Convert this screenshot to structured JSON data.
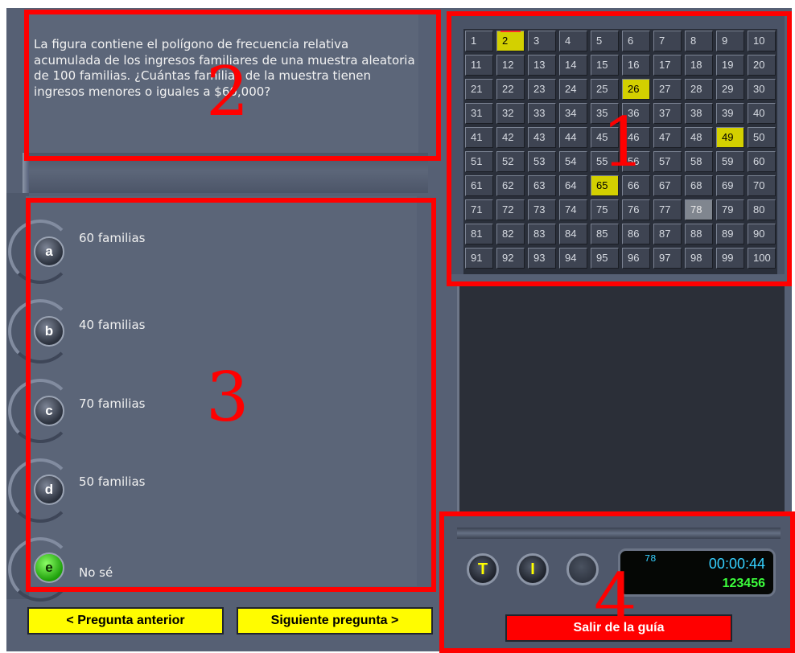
{
  "question": {
    "text": "La figura contiene el polígono de frecuencia relativa acumulada de los ingresos familiares de una muestra aleatoria de 100 familias. ¿Cuántas familias de la muestra tienen ingresos menores o iguales a $60,000?"
  },
  "answers": [
    {
      "letter": "a",
      "label": "60 familias"
    },
    {
      "letter": "b",
      "label": "40 familias"
    },
    {
      "letter": "c",
      "label": "70 familias"
    },
    {
      "letter": "d",
      "label": "50 familias"
    },
    {
      "letter": "e",
      "label": "No sé"
    }
  ],
  "nav": {
    "prev_label": "< Pregunta anterior",
    "next_label": "Siguiente pregunta >"
  },
  "grid": {
    "numbers": [
      "1",
      "2",
      "3",
      "4",
      "5",
      "6",
      "7",
      "8",
      "9",
      "10",
      "11",
      "12",
      "13",
      "14",
      "15",
      "16",
      "17",
      "18",
      "19",
      "20",
      "21",
      "22",
      "23",
      "24",
      "25",
      "26",
      "27",
      "28",
      "29",
      "30",
      "31",
      "32",
      "33",
      "34",
      "35",
      "36",
      "37",
      "38",
      "39",
      "40",
      "41",
      "42",
      "43",
      "44",
      "45",
      "46",
      "47",
      "48",
      "49",
      "50",
      "51",
      "52",
      "53",
      "54",
      "55",
      "56",
      "57",
      "58",
      "59",
      "60",
      "61",
      "62",
      "63",
      "64",
      "65",
      "66",
      "67",
      "68",
      "69",
      "70",
      "71",
      "72",
      "73",
      "74",
      "75",
      "76",
      "77",
      "78",
      "79",
      "80",
      "81",
      "82",
      "83",
      "84",
      "85",
      "86",
      "87",
      "88",
      "89",
      "90",
      "91",
      "92",
      "93",
      "94",
      "95",
      "96",
      "97",
      "98",
      "99",
      "100"
    ],
    "current": 2,
    "answered": [
      26,
      49,
      65
    ],
    "visited": [
      78
    ]
  },
  "status": {
    "btn_t": "T",
    "btn_i": "I",
    "question_count": "78",
    "timer": "00:00:44",
    "user_id": "123456",
    "exit_label": "Salir de la guía"
  },
  "markers": {
    "m1": "1",
    "m2": "2",
    "m3": "3",
    "m4": "4"
  },
  "colors": {
    "app_bg": "#566074",
    "highlight_yellow": "#d3d000",
    "annotation_red": "#ff0000",
    "nav_yellow": "#fffc00",
    "timer_cyan": "#35d0ff",
    "id_green": "#3cff3c"
  }
}
